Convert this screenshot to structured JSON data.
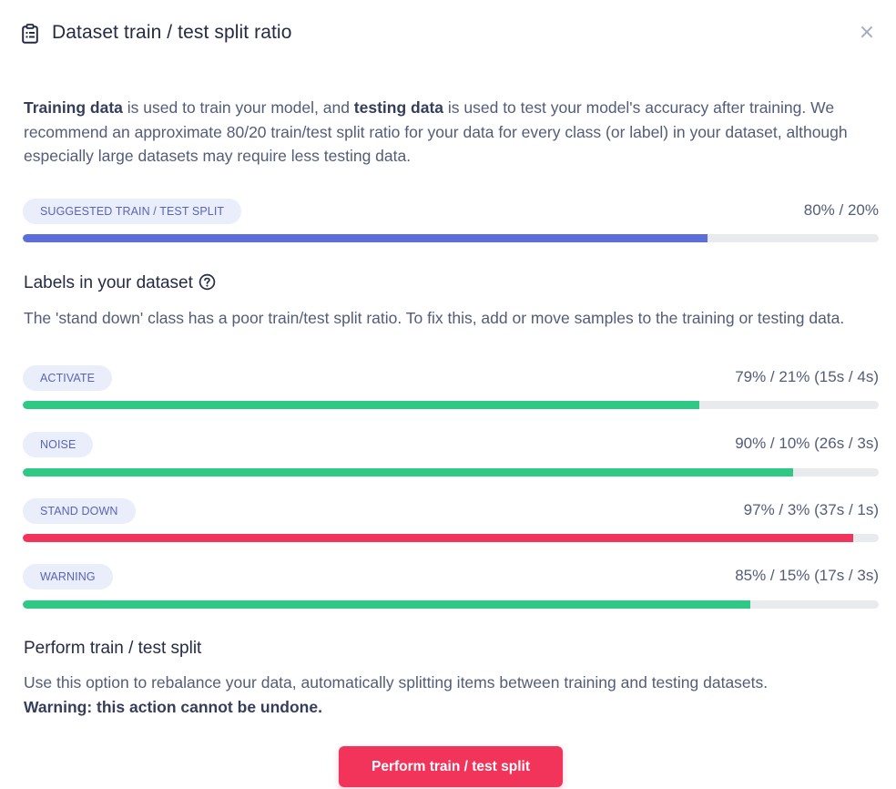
{
  "header": {
    "title": "Dataset train / test split ratio",
    "icon": "clipboard-icon",
    "close_label": "×"
  },
  "intro": {
    "part1_bold": "Training data",
    "part2": " is used to train your model, and ",
    "part3_bold": "testing data",
    "part4": " is used to test your model's accuracy after training. We recommend an approximate 80/20 train/test split ratio for your data for every class (or label) in your dataset, although especially large datasets may require less testing data."
  },
  "suggested": {
    "label": "SUGGESTED TRAIN / TEST SPLIT",
    "ratio": "80% / 20%",
    "train_fraction": 0.8,
    "color": "#5b6ed9"
  },
  "labels_section": {
    "title": "Labels in your dataset",
    "help_icon": "question-circle-icon",
    "message": "The 'stand down' class has a poor train/test split ratio. To fix this, add or move samples to the training or testing data.",
    "items": [
      {
        "label": "ACTIVATE",
        "ratio": "79% / 21% (15s / 4s)",
        "train_fraction": 0.79,
        "color": "#2ec985"
      },
      {
        "label": "NOISE",
        "ratio": "90% / 10% (26s / 3s)",
        "train_fraction": 0.9,
        "color": "#2ec985"
      },
      {
        "label": "STAND DOWN",
        "ratio": "97% / 3% (37s / 1s)",
        "train_fraction": 0.97,
        "color": "#f2345a"
      },
      {
        "label": "WARNING",
        "ratio": "85% / 15% (17s / 3s)",
        "train_fraction": 0.85,
        "color": "#2ec985"
      }
    ]
  },
  "perform": {
    "title": "Perform train / test split",
    "description": "Use this option to rebalance your data, automatically splitting items between training and testing datasets.",
    "warning": "Warning: this action cannot be undone.",
    "button_label": "Perform train / test split"
  },
  "colors": {
    "track": "#e8eaee",
    "badge_bg": "#eaedfa",
    "badge_text": "#5a64b8",
    "primary_action": "#f2345a"
  }
}
